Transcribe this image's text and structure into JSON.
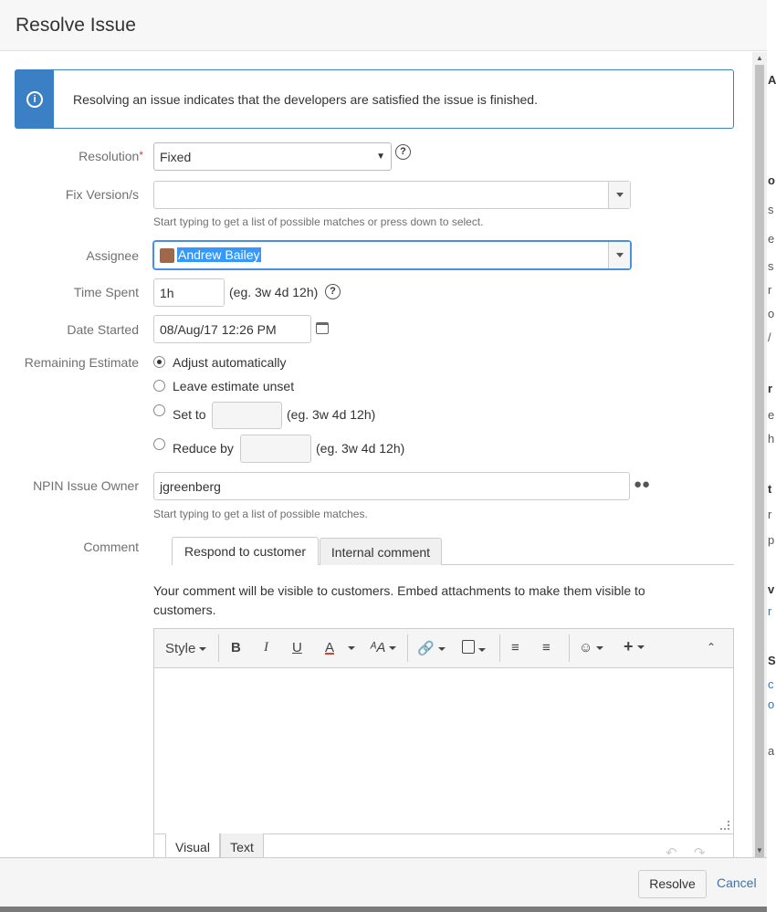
{
  "dialog": {
    "title": "Resolve Issue"
  },
  "info": {
    "message": "Resolving an issue indicates that the developers are satisfied the issue is finished."
  },
  "resolution": {
    "label": "Resolution",
    "required_mark": "*",
    "value": "Fixed"
  },
  "fix_version": {
    "label": "Fix Version/s",
    "value": "",
    "hint": "Start typing to get a list of possible matches or press down to select."
  },
  "assignee": {
    "label": "Assignee",
    "value": "Andrew Bailey"
  },
  "time_spent": {
    "label": "Time Spent",
    "value": "1h",
    "example": "(eg. 3w 4d 12h)"
  },
  "date_started": {
    "label": "Date Started",
    "value": "08/Aug/17 12:26 PM"
  },
  "remaining_estimate": {
    "label": "Remaining Estimate",
    "options": [
      {
        "label": "Adjust automatically",
        "selected": true
      },
      {
        "label": "Leave estimate unset",
        "selected": false
      },
      {
        "label": "Set to",
        "selected": false,
        "example": "(eg. 3w 4d 12h)"
      },
      {
        "label": "Reduce by",
        "selected": false,
        "example": "(eg. 3w 4d 12h)"
      }
    ]
  },
  "npin_owner": {
    "label": "NPIN Issue Owner",
    "value": "jgreenberg",
    "hint": "Start typing to get a list of possible matches."
  },
  "comment": {
    "label": "Comment",
    "tabs": [
      "Respond to customer",
      "Internal comment"
    ],
    "visibility_note": "Your comment will be visible to customers. Embed attachments to make them visible to customers.",
    "toolbar": {
      "style_label": "Style",
      "bold": "B",
      "italic": "I",
      "underline": "U",
      "text_color": "A"
    },
    "editor_tabs": [
      "Visual",
      "Text"
    ]
  },
  "footer": {
    "resolve_label": "Resolve",
    "cancel_label": "Cancel"
  },
  "colors": {
    "accent": "#3b7fc4",
    "required": "#d04437",
    "link": "#3b73af",
    "selection": "#3399ff"
  }
}
